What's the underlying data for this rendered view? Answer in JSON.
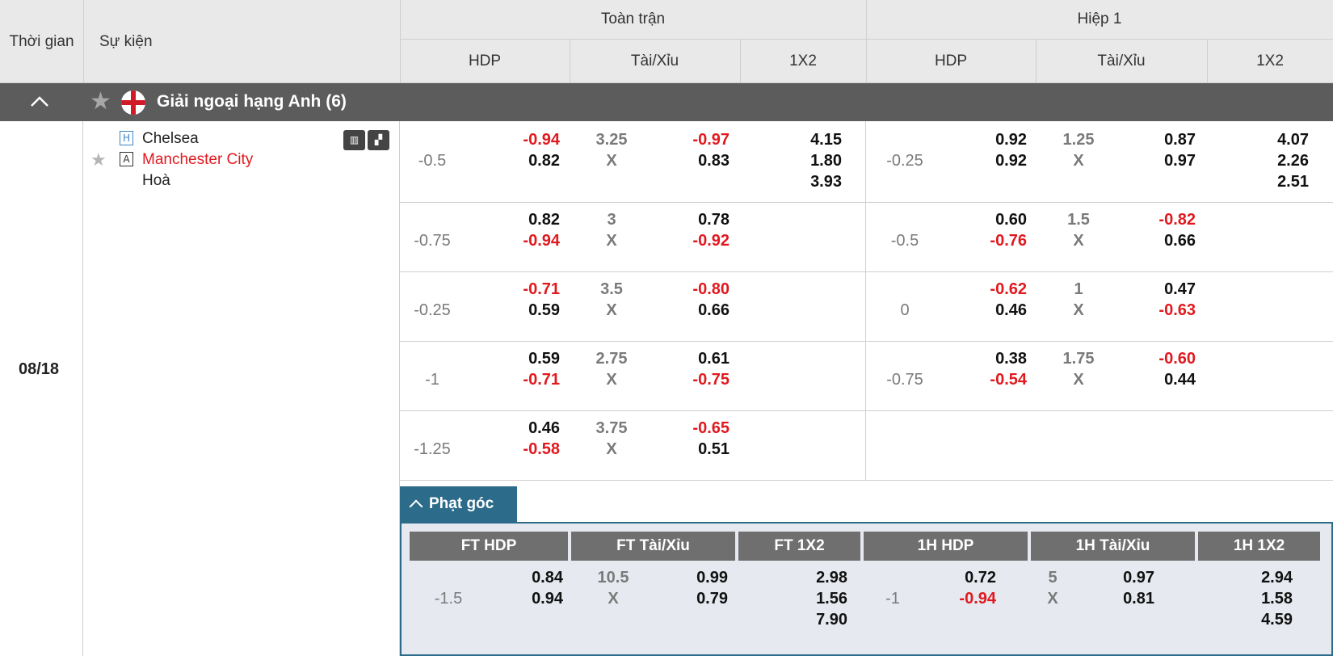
{
  "header": {
    "time": "Thời gian",
    "event": "Sự kiện",
    "full_match": "Toàn trận",
    "first_half": "Hiệp 1",
    "hdp": "HDP",
    "ou": "Tài/Xỉu",
    "x12": "1X2"
  },
  "league": {
    "name": "Giải ngoại hạng Anh (6)"
  },
  "match": {
    "time": "08/18",
    "home_badge": "H",
    "away_badge": "A",
    "home": "Chelsea",
    "away": "Manchester City",
    "draw": "Hoà"
  },
  "odds_rows": [
    {
      "ft_hdp": "-0.5",
      "ft_h1": "-0.94",
      "ft_h2": "0.82",
      "ft_ou": "3.25",
      "ft_ox": "X",
      "ft_o1": "-0.97",
      "ft_o2": "0.83",
      "ft_1": "4.15",
      "ft_x": "1.80",
      "ft_2": "3.93",
      "h1_hdp": "-0.25",
      "h1_h1": "0.92",
      "h1_h2": "0.92",
      "h1_ou": "1.25",
      "h1_ox": "X",
      "h1_o1": "0.87",
      "h1_o2": "0.97",
      "h1_1": "4.07",
      "h1_x": "2.26",
      "h1_2": "2.51"
    },
    {
      "ft_hdp": "-0.75",
      "ft_h1": "0.82",
      "ft_h2": "-0.94",
      "ft_ou": "3",
      "ft_ox": "X",
      "ft_o1": "0.78",
      "ft_o2": "-0.92",
      "h1_hdp": "-0.5",
      "h1_h1": "0.60",
      "h1_h2": "-0.76",
      "h1_ou": "1.5",
      "h1_ox": "X",
      "h1_o1": "-0.82",
      "h1_o2": "0.66"
    },
    {
      "ft_hdp": "-0.25",
      "ft_h1": "-0.71",
      "ft_h2": "0.59",
      "ft_ou": "3.5",
      "ft_ox": "X",
      "ft_o1": "-0.80",
      "ft_o2": "0.66",
      "h1_hdp": "0",
      "h1_h1": "-0.62",
      "h1_h2": "0.46",
      "h1_ou": "1",
      "h1_ox": "X",
      "h1_o1": "0.47",
      "h1_o2": "-0.63"
    },
    {
      "ft_hdp": "-1",
      "ft_h1": "0.59",
      "ft_h2": "-0.71",
      "ft_ou": "2.75",
      "ft_ox": "X",
      "ft_o1": "0.61",
      "ft_o2": "-0.75",
      "h1_hdp": "-0.75",
      "h1_h1": "0.38",
      "h1_h2": "-0.54",
      "h1_ou": "1.75",
      "h1_ox": "X",
      "h1_o1": "-0.60",
      "h1_o2": "0.44"
    },
    {
      "ft_hdp": "-1.25",
      "ft_h1": "0.46",
      "ft_h2": "-0.58",
      "ft_ou": "3.75",
      "ft_ox": "X",
      "ft_o1": "-0.65",
      "ft_o2": "0.51"
    }
  ],
  "corner": {
    "tab": "Phạt góc",
    "headers": [
      "FT HDP",
      "FT Tài/Xỉu",
      "FT 1X2",
      "1H HDP",
      "1H Tài/Xỉu",
      "1H 1X2"
    ],
    "ft_hdp": "-1.5",
    "ft_h1": "0.84",
    "ft_h2": "0.94",
    "ft_ou": "10.5",
    "ft_ox": "X",
    "ft_o1": "0.99",
    "ft_o2": "0.79",
    "ft_1": "2.98",
    "ft_x": "1.56",
    "ft_2": "7.90",
    "h1_hdp": "-1",
    "h1_h1": "0.72",
    "h1_h2": "-0.94",
    "h1_ou": "5",
    "h1_ox": "X",
    "h1_o1": "0.97",
    "h1_o2": "0.81",
    "h1_1": "2.94",
    "h1_x": "1.58",
    "h1_2": "4.59"
  },
  "colors": {
    "negative": "#e0191f",
    "league_bar": "#5c5c5c",
    "corner_accent": "#2c6b8a"
  }
}
